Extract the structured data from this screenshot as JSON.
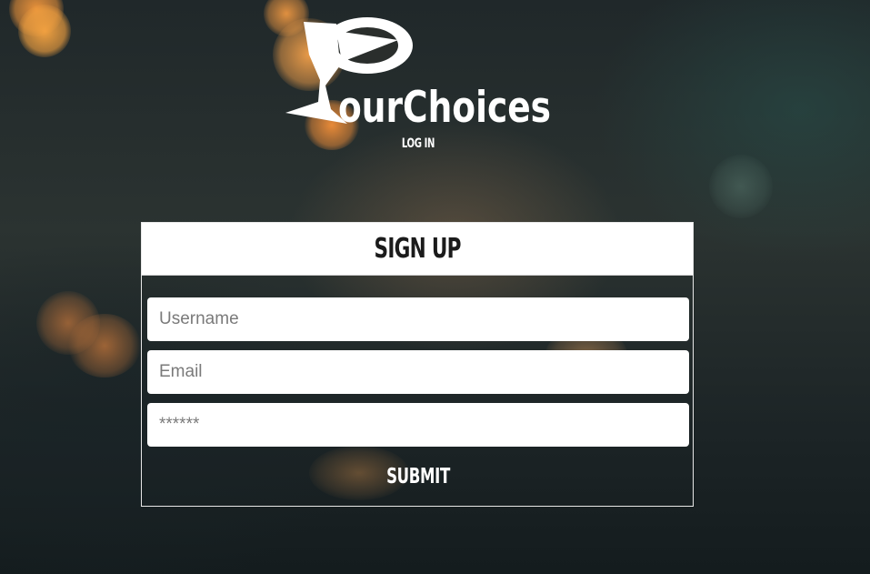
{
  "brand": {
    "name": "ourChoices"
  },
  "nav": {
    "login_label": "LOG IN"
  },
  "signup": {
    "title": "SIGN UP",
    "username_placeholder": "Username",
    "email_placeholder": "Email",
    "password_placeholder": "******",
    "submit_label": "SUBMIT"
  },
  "colors": {
    "card_header_bg": "#ffffff",
    "text_light": "#ffffff",
    "text_dark": "#1b1b1b",
    "bokeh_orange": "#f0a040"
  },
  "icons": {
    "logo_mark": "glass-flag-logo-icon"
  }
}
